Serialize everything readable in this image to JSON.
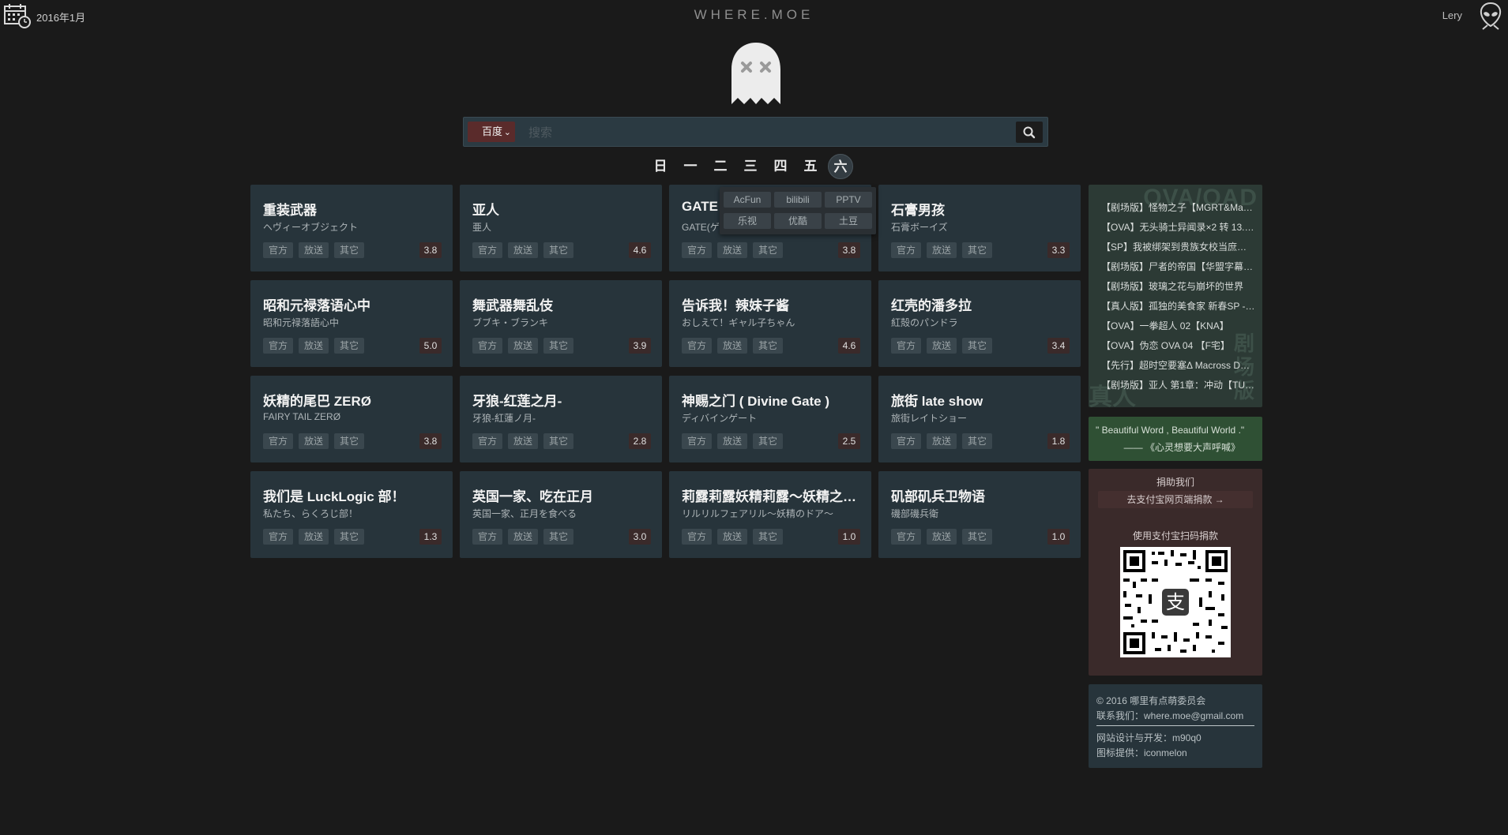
{
  "header": {
    "date": "2016年1月",
    "site_title": "WHERE.MOE",
    "user": "Lery",
    "calendar_icon": "calendar-icon",
    "user_icon": "alien-icon"
  },
  "search": {
    "engine": "百度",
    "placeholder": "搜索",
    "button_icon": "search-icon"
  },
  "days": [
    "日",
    "一",
    "二",
    "三",
    "四",
    "五",
    "六"
  ],
  "active_day": "六",
  "tag_labels": [
    "官方",
    "放送",
    "其它"
  ],
  "cards": [
    {
      "title": "重装武器",
      "subtitle": "ヘヴィーオブジェクト",
      "score": "3.8"
    },
    {
      "title": "亚人",
      "subtitle": "亜人",
      "score": "4.6"
    },
    {
      "title": "GATE",
      "subtitle": "GATE(ゲ",
      "score": "3.8"
    },
    {
      "title": "石膏男孩",
      "subtitle": "石膏ボーイズ",
      "score": "3.3"
    },
    {
      "title": "昭和元禄落语心中",
      "subtitle": "昭和元禄落語心中",
      "score": "5.0"
    },
    {
      "title": "舞武器舞乱伎",
      "subtitle": "ブブキ・ブランキ",
      "score": "3.9"
    },
    {
      "title": "告诉我！辣妹子酱",
      "subtitle": "おしえて！ギャル子ちゃん",
      "score": "4.6"
    },
    {
      "title": "红壳的潘多拉",
      "subtitle": "紅殻のパンドラ",
      "score": "3.4"
    },
    {
      "title": "妖精的尾巴 ZERØ",
      "subtitle": "FAIRY TAIL ZERØ",
      "score": "3.8"
    },
    {
      "title": "牙狼-红莲之月-",
      "subtitle": "牙狼-紅蓮ノ月-",
      "score": "2.8"
    },
    {
      "title": "神赐之门 ( Divine Gate )",
      "subtitle": "ディバインゲート",
      "score": "2.5"
    },
    {
      "title": "旅街 late show",
      "subtitle": "旅街レイトショー",
      "score": "1.8"
    },
    {
      "title": "我们是 LuckLogic 部！",
      "subtitle": "私たち、らくろじ部！",
      "score": "1.3"
    },
    {
      "title": "英国一家、吃在正月",
      "subtitle": "英国一家、正月を食べる",
      "score": "3.0"
    },
    {
      "title": "莉露莉露妖精莉露～妖精之…",
      "subtitle": "リルリルフェアリル～妖精のドア～",
      "score": "1.0"
    },
    {
      "title": "矶部矶兵卫物语",
      "subtitle": "磯部磯兵衛",
      "score": "1.0"
    }
  ],
  "sources_popup": [
    "AcFun",
    "bilibili",
    "PPTV",
    "乐视",
    "优酷",
    "土豆"
  ],
  "ova": {
    "watermark": "OVA/OAD",
    "watermark_side": "剧场版",
    "watermark_bottom": "真人",
    "items": [
      "【剧场版】怪物之子【MGRT&Ma…",
      "【OVA】无头骑士异闻录×2 转 13.…",
      "【SP】我被绑架到贵族女校当庶…",
      "【剧场版】尸者的帝国【华盟字幕…",
      "【剧场版】玻璃之花与崩坏的世界",
      "【真人版】孤独的美食家 新春SP -…",
      "【OVA】一拳超人 02【KNA】",
      "【OVA】伪恋 OVA 04 【F宅】",
      "【先行】超时空要塞Δ Macross D…",
      "【剧场版】亚人 第1章：冲动【TU…"
    ]
  },
  "quote": {
    "text": "\" Beautiful Word , Beautiful World .\"",
    "source": "—— 《心灵想要大声呼喊》"
  },
  "donate": {
    "title": "捐助我们",
    "button": "去支付宝网页端捐款 →",
    "note": "使用支付宝扫码捐款",
    "qr_icon": "alipay-qr-icon"
  },
  "footer": {
    "copyright": "© 2016 哪里有点萌委员会",
    "contact": "联系我们：where.moe@gmail.com",
    "design": "网站设计与开发：m90q0",
    "icons": "图标提供：iconmelon"
  },
  "colors": {
    "background": "#1a1a1a",
    "card": "#27343b",
    "score_bg": "#3a2a2a",
    "ova_bg": "#2c3a35",
    "quote_bg": "#2f5034",
    "donate_bg": "#3a2a2a"
  }
}
